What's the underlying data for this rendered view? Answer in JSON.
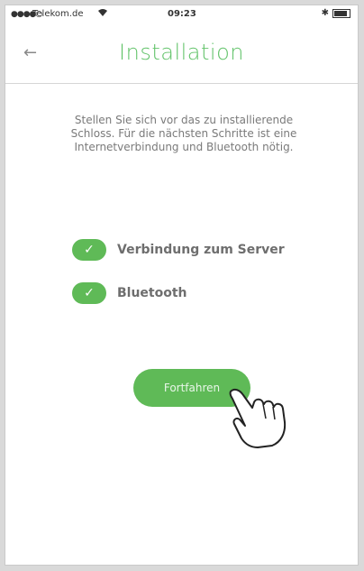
{
  "statusbar": {
    "carrier": "Telekom.de",
    "time": "09:23"
  },
  "header": {
    "title": "Installation",
    "back_icon": "arrow-left-icon"
  },
  "instructions": "Stellen Sie sich vor das zu installierende Schloss. Für die nächsten Schritte ist eine Internetverbindung und Bluetooth nötig.",
  "checks": [
    {
      "label": "Verbindung zum Server",
      "status": "checked"
    },
    {
      "label": "Bluetooth",
      "status": "checked"
    }
  ],
  "continue_button": {
    "label": "Fortfahren"
  },
  "colors": {
    "accent": "#5fba57",
    "title_green": "#62c36a",
    "text_gray": "#7a7a7a"
  }
}
